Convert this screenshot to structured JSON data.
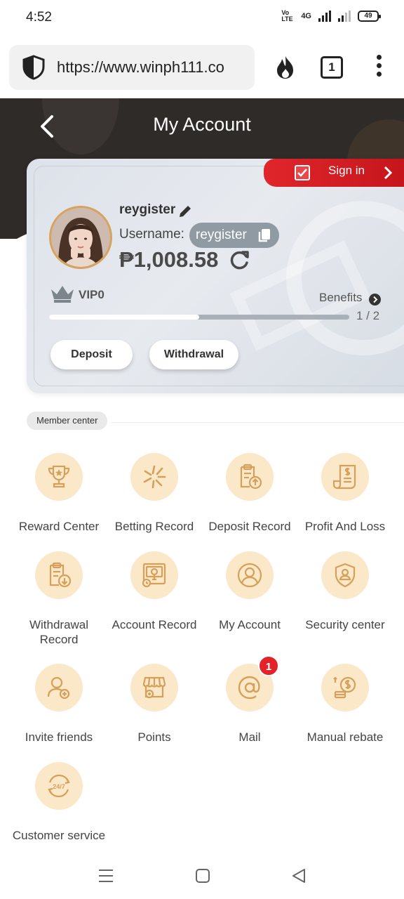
{
  "status_bar": {
    "time": "4:52",
    "network": "4G",
    "volte": "Vo LTE",
    "battery": "49"
  },
  "browser": {
    "url": "https://www.winph111.co",
    "tab_count": "1"
  },
  "header": {
    "title": "My Account"
  },
  "card": {
    "sign_in_label": "Sign in",
    "nickname": "reygister",
    "username_label": "Username:",
    "username": "reygister",
    "balance": "₱1,008.58",
    "vip_level": "VIP0",
    "benefits_label": "Benefits",
    "progress_text": "1 / 2",
    "progress_fraction": 0.5,
    "deposit_label": "Deposit",
    "withdrawal_label": "Withdrawal"
  },
  "member_center": {
    "title": "Member center",
    "items": [
      {
        "label": "Reward Center",
        "icon": "trophy-icon"
      },
      {
        "label": "Betting Record",
        "icon": "burst-icon"
      },
      {
        "label": "Deposit Record",
        "icon": "clipboard-up-icon"
      },
      {
        "label": "Profit And Loss",
        "icon": "receipt-icon"
      },
      {
        "label": "Withdrawal Record",
        "icon": "clipboard-down-icon"
      },
      {
        "label": "Account Record",
        "icon": "ledger-icon"
      },
      {
        "label": "My Account",
        "icon": "user-circle-icon"
      },
      {
        "label": "Security center",
        "icon": "shield-user-icon"
      },
      {
        "label": "Invite friends",
        "icon": "add-user-icon"
      },
      {
        "label": "Points",
        "icon": "store-icon"
      },
      {
        "label": "Mail",
        "icon": "at-icon",
        "badge": "1"
      },
      {
        "label": "Manual rebate",
        "icon": "coins-icon"
      },
      {
        "label": "Customer service",
        "icon": "support-24-7-icon"
      }
    ]
  },
  "colors": {
    "accent_gold": "#fbe8c8",
    "icon_stroke": "#d4a05a",
    "sign_in_red": "#d81e24",
    "header_dark": "#2f2b29"
  }
}
